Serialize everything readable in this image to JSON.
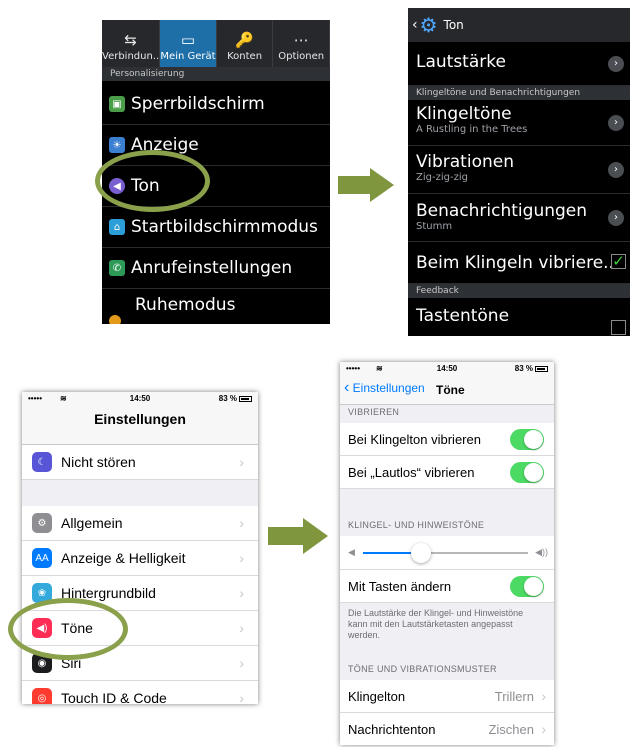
{
  "android_main": {
    "tabs": [
      {
        "label": "Verbindun..",
        "icon": "connections-icon",
        "active": false
      },
      {
        "label": "Mein Gerät",
        "icon": "device-icon",
        "active": true
      },
      {
        "label": "Konten",
        "icon": "accounts-icon",
        "active": false
      },
      {
        "label": "Optionen",
        "icon": "more-icon",
        "active": false
      }
    ],
    "section": "Personalisierung",
    "items": [
      {
        "label": "Sperrbildschirm",
        "icon": "lockscreen-icon",
        "color": "#4a9e4a"
      },
      {
        "label": "Anzeige",
        "icon": "display-icon",
        "color": "#3a7fd0"
      },
      {
        "label": "Ton",
        "icon": "sound-icon",
        "color": "#7a5fd0"
      },
      {
        "label": "Startbildschirmmodus",
        "icon": "home-icon",
        "color": "#2d9fd8"
      },
      {
        "label": "Anrufeinstellungen",
        "icon": "call-icon",
        "color": "#2e9a58"
      },
      {
        "label": "Ruhemodus",
        "icon": "sleep-icon",
        "color": "#e39a1a"
      }
    ]
  },
  "android_sound": {
    "title": "Ton",
    "rows": {
      "volume": "Lautstärke",
      "section_ringtones": "Klingeltöne und Benachrichtigungen",
      "ringtones": "Klingeltöne",
      "ringtones_sub": "A Rustling in the Trees",
      "vibrations": "Vibrationen",
      "vibrations_sub": "Zig-zig-zig",
      "notifications": "Benachrichtigungen",
      "notifications_sub": "Stumm",
      "vibrate_on_ring": "Beim Klingeln vibriere..",
      "vibrate_on_ring_checked": true,
      "section_feedback": "Feedback",
      "key_tones": "Tastentöne",
      "key_tones_checked": false
    }
  },
  "ios_main": {
    "status": {
      "signal": "•••••",
      "time": "14:50",
      "battery": "83 %"
    },
    "title": "Einstellungen",
    "items": [
      {
        "label": "Nicht stören",
        "icon": "moon-icon",
        "color": "#5856d6"
      },
      {
        "label": "Allgemein",
        "icon": "gear-icon",
        "color": "#8e8e93"
      },
      {
        "label": "Anzeige & Helligkeit",
        "icon": "aa-icon",
        "color": "#007aff"
      },
      {
        "label": "Hintergrundbild",
        "icon": "wallpaper-icon",
        "color": "#34aadc"
      },
      {
        "label": "Töne",
        "icon": "speaker-icon",
        "color": "#ff2d55"
      },
      {
        "label": "Siri",
        "icon": "siri-icon",
        "color": "#1c1c1e"
      },
      {
        "label": "Touch ID & Code",
        "icon": "fingerprint-icon",
        "color": "#ff3b30"
      }
    ]
  },
  "ios_sounds": {
    "status": {
      "signal": "•••••",
      "time": "14:50",
      "battery": "83 %"
    },
    "back_label": "Einstellungen",
    "title": "Töne",
    "section_vibrate": "VIBRIEREN",
    "vibrate_ring": "Bei Klingelton vibrieren",
    "vibrate_silent": "Bei „Lautlos“ vibrieren",
    "section_ringer": "KLINGEL- UND HINWEISTÖNE",
    "volume_level": 0.35,
    "change_with_buttons": "Mit Tasten ändern",
    "footer_note": "Die Lautstärke der Klingel- und Hinweistöne kann mit den Lautstärketasten angepasst werden.",
    "section_patterns": "TÖNE UND VIBRATIONSMUSTER",
    "ringtone_label": "Klingelton",
    "ringtone_value": "Trillern",
    "message_label": "Nachrichtenton",
    "message_value": "Zischen"
  },
  "colors": {
    "arrow": "#7f963f",
    "highlight": "#8aa04b",
    "toggle_on": "#4cd964",
    "ios_blue": "#007aff"
  }
}
